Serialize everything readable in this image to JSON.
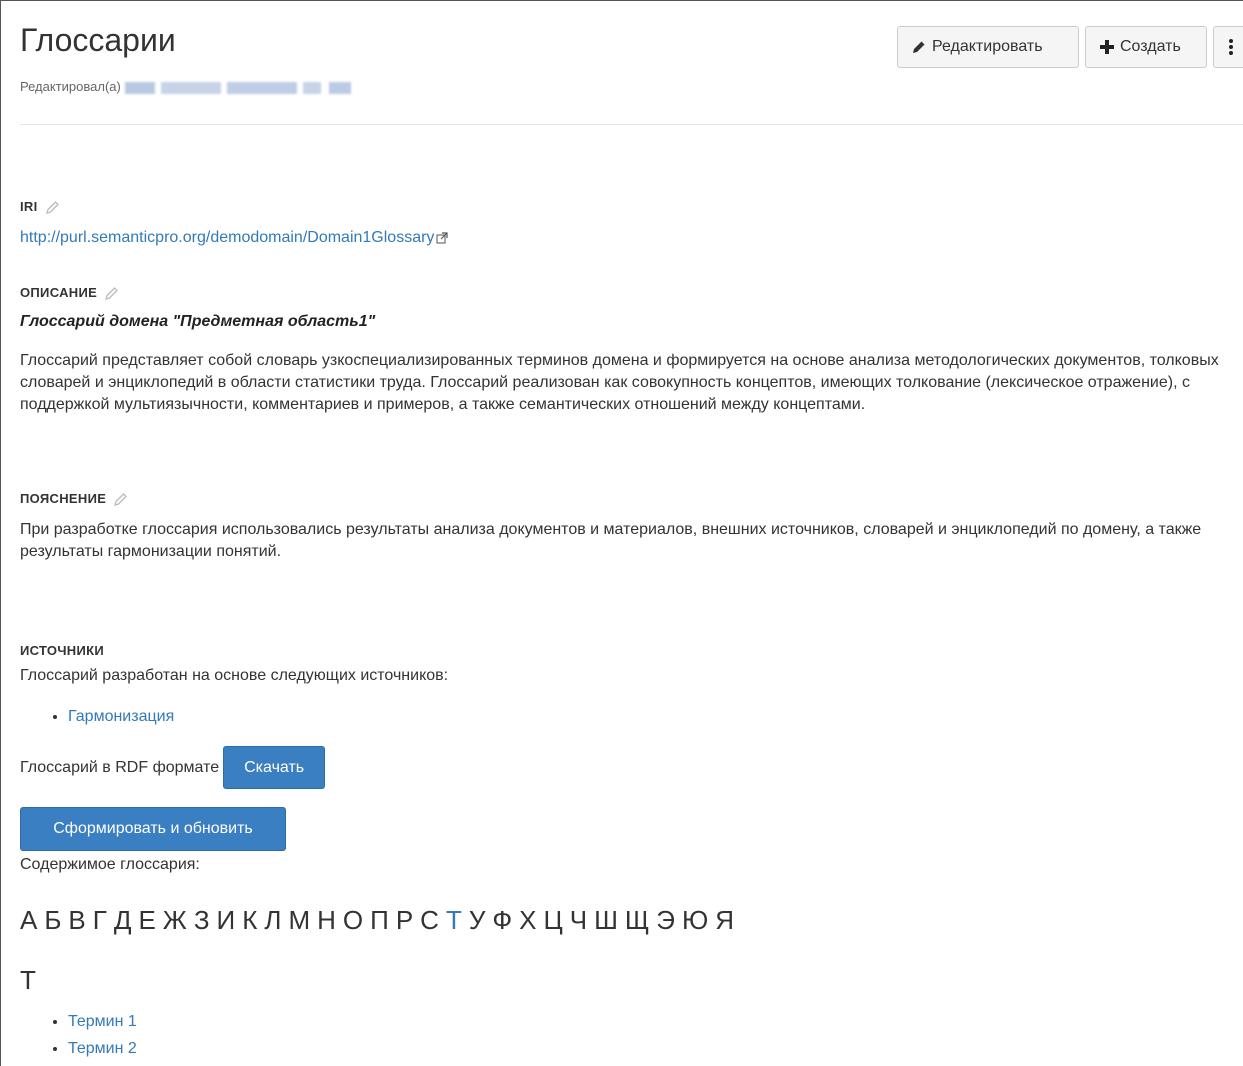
{
  "header": {
    "title": "Глоссарии",
    "edited_by_label": "Редактировал(а)",
    "edit_button": "Редактировать",
    "create_button": "Создать"
  },
  "iri": {
    "label": "IRI",
    "url": "http://purl.semanticpro.org/demodomain/Domain1Glossary"
  },
  "description": {
    "label": "ОПИСАНИЕ",
    "title": "Глоссарий домена \"Предметная область1\"",
    "body": "Глоссарий представляет собой словарь узкоспециализированных терминов домена и формируется на основе анализа методологических документов, толковых словарей и энциклопедий в области статистики труда. Глоссарий  реализован как совокупность концептов, имеющих толкование (лексическое отражение), с поддержкой мультиязычности, комментариев и примеров, а также семантических отношений между концептами."
  },
  "explanation": {
    "label": "ПОЯСНЕНИЕ",
    "body": "При разработке глоссария использовались результаты анализа документов и материалов, внешних источников, словарей и энциклопедий по домену, а также результаты гармонизации понятий."
  },
  "sources": {
    "label": "ИСТОЧНИКИ",
    "intro": "Глоссарий разработан на основе следующих источников:",
    "items": [
      "Гармонизация"
    ]
  },
  "rdf": {
    "label": "Глоссарий в RDF формате",
    "download_button": "Скачать"
  },
  "generate_button": "Сформировать и обновить",
  "content_label": "Содержимое глоссария:",
  "alphabet": [
    "А",
    "Б",
    "В",
    "Г",
    "Д",
    "Е",
    "Ж",
    "З",
    "И",
    "К",
    "Л",
    "М",
    "Н",
    "О",
    "П",
    "Р",
    "С",
    "Т",
    "У",
    "Ф",
    "Х",
    "Ц",
    "Ч",
    "Ш",
    "Щ",
    "Э",
    "Ю",
    "Я"
  ],
  "active_letter": "Т",
  "terms": {
    "heading": "Т",
    "items": [
      "Термин 1",
      "Термин 2"
    ]
  },
  "colors": {
    "link": "#337ab7",
    "primary_button": "#3a7fc2"
  }
}
